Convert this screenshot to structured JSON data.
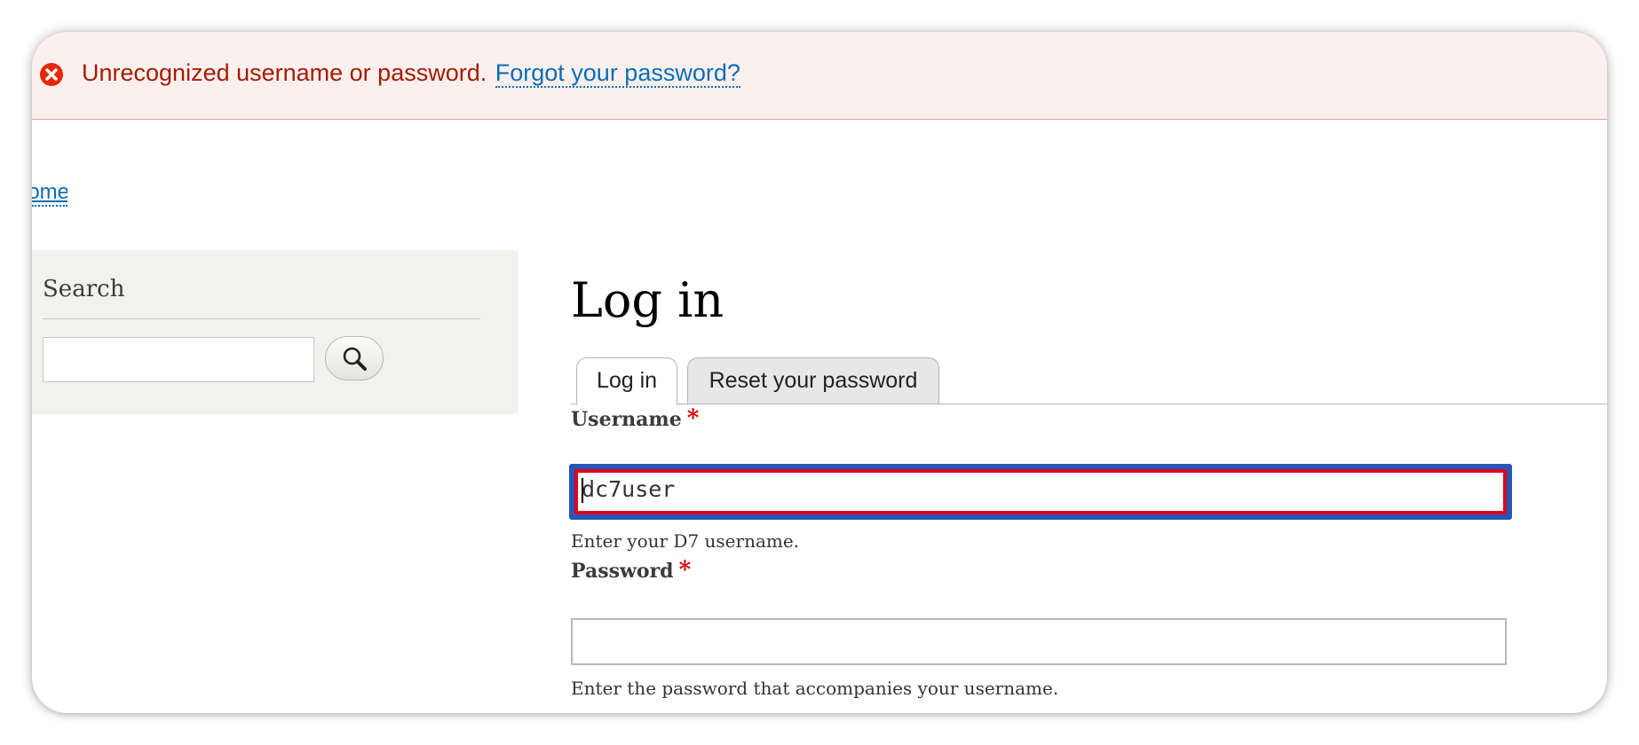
{
  "messages": {
    "error_text": "Unrecognized username or password.",
    "error_link": "Forgot your password?",
    "error_color": "#a51b00",
    "icon": "error-circle-x-icon"
  },
  "breadcrumb": {
    "home_label": "Home"
  },
  "sidebar": {
    "search_title": "Search",
    "search_value": "",
    "search_button_icon": "magnifier-icon"
  },
  "main": {
    "title": "Log in",
    "tabs": [
      {
        "label": "Log in",
        "active": true
      },
      {
        "label": "Reset your password",
        "active": false
      }
    ],
    "username": {
      "label": "Username",
      "required_mark": "*",
      "value": "dc7user",
      "description": "Enter your D7 username."
    },
    "password": {
      "label": "Password",
      "required_mark": "*",
      "value": "",
      "description": "Enter the password that accompanies your username."
    }
  },
  "colors": {
    "link": "#0a6eb4",
    "error_bg": "#fcf0ef",
    "sidebar_bg": "#f2f2ed",
    "focus_outline": "#2556b8",
    "error_border": "#e0001a"
  }
}
